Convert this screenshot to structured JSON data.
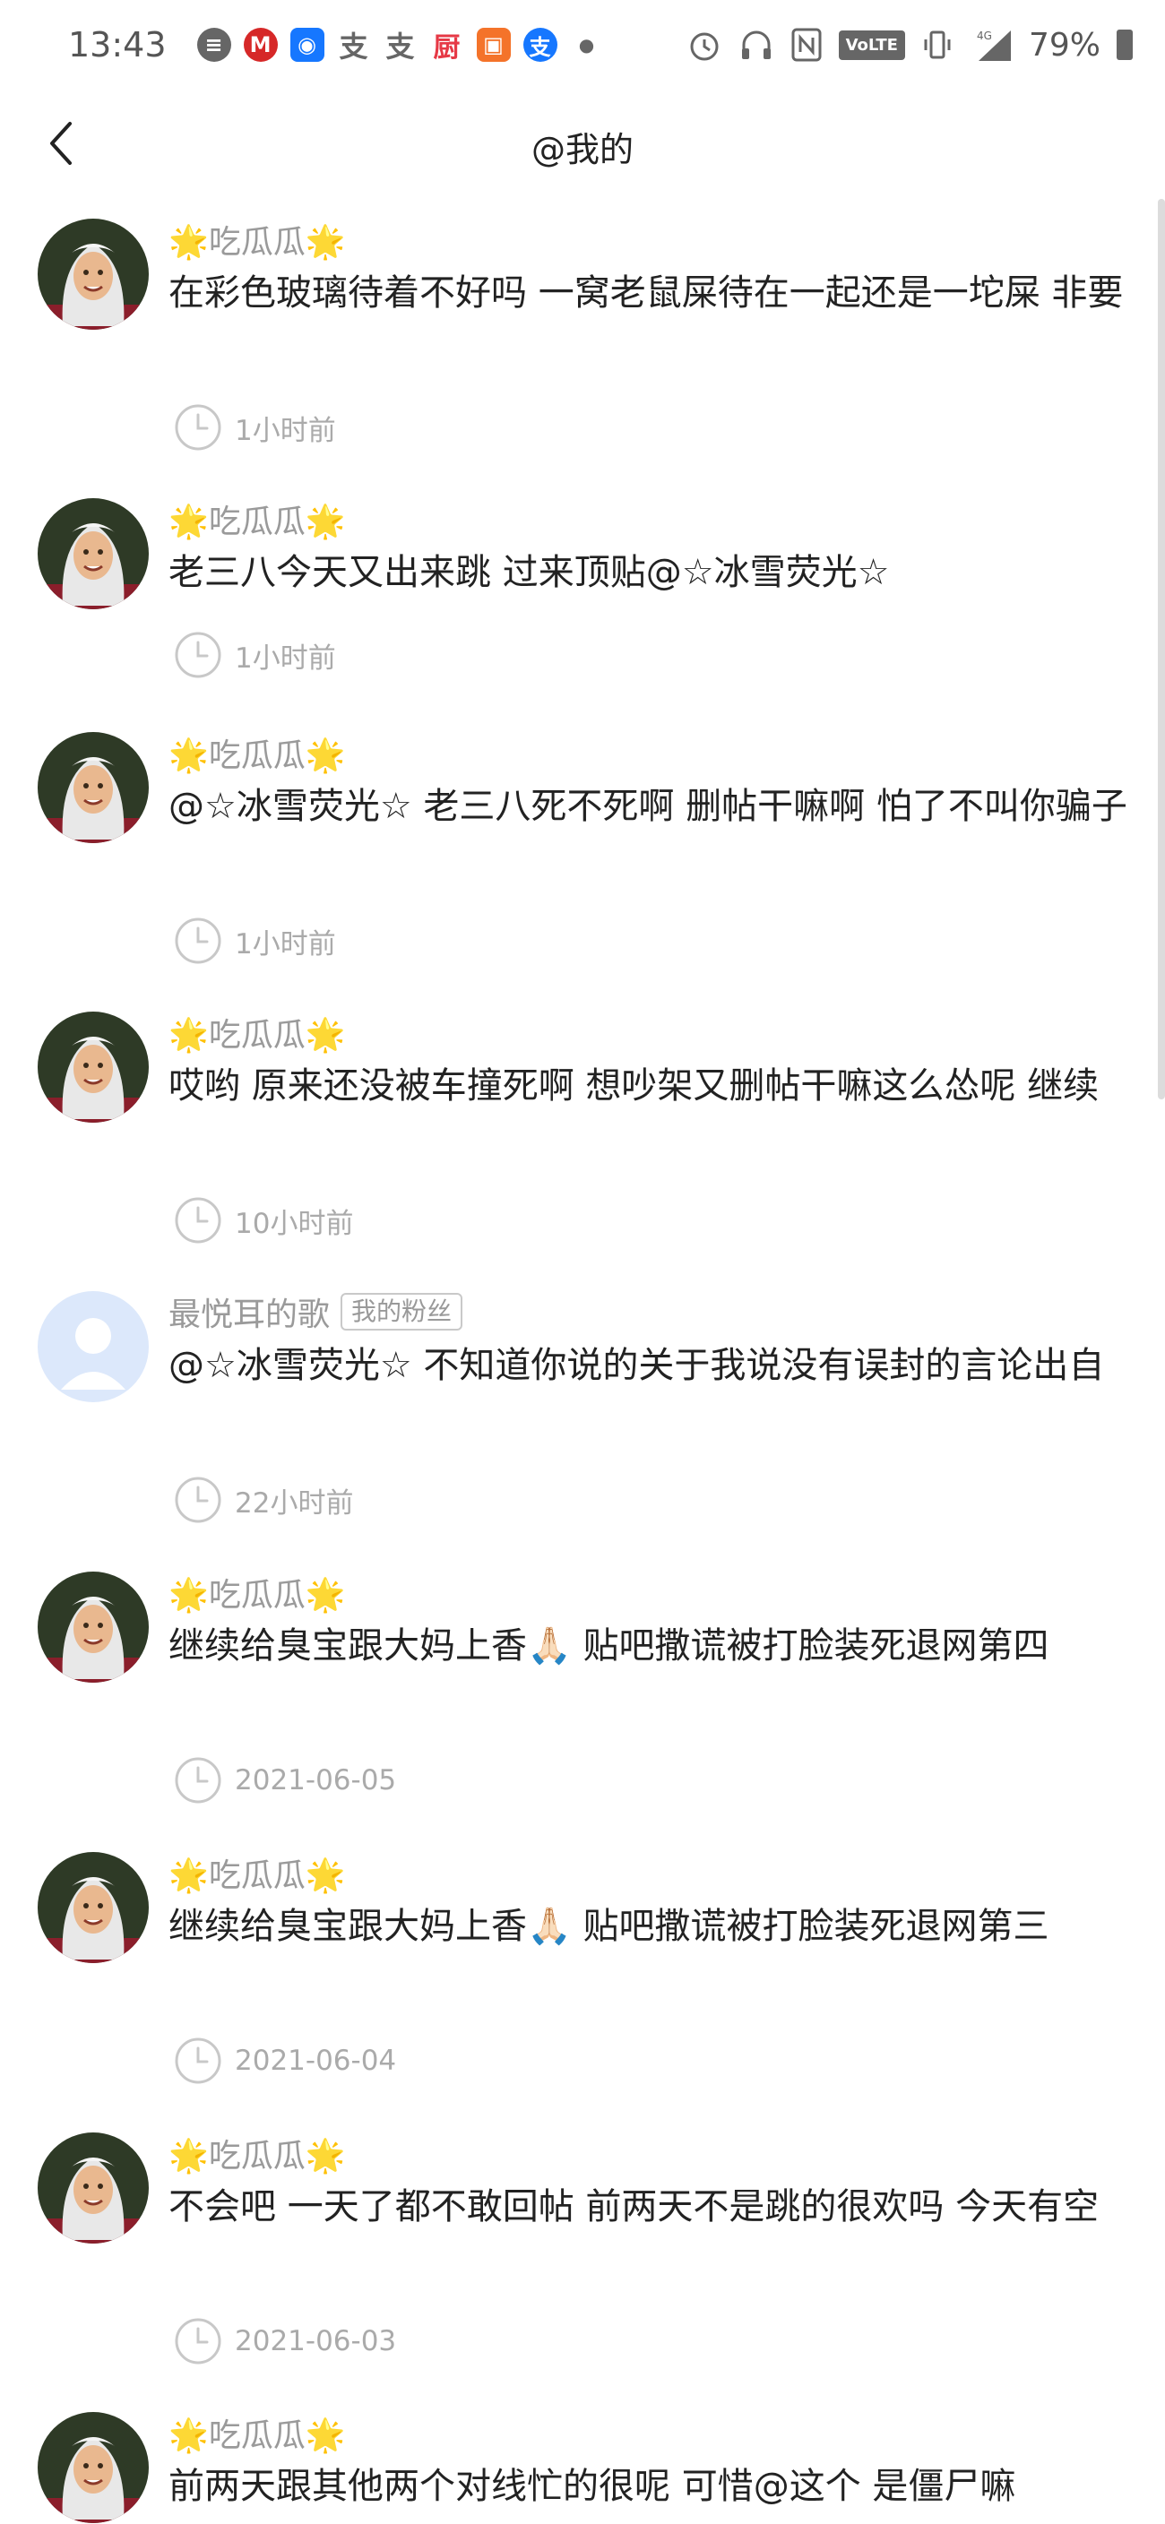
{
  "status_bar": {
    "time": "13:43",
    "network": "4G",
    "volte": "VoLTE",
    "battery": "79%"
  },
  "header": {
    "title": "@我的"
  },
  "comments": [
    {
      "user": "🌟吃瓜瓜🌟",
      "avatar": "user-avatar",
      "badge": "",
      "content": "在彩色玻璃待着不好吗 一窝老鼠屎待在一起还是一坨屎 非要",
      "time": "1小时前"
    },
    {
      "user": "🌟吃瓜瓜🌟",
      "avatar": "user-avatar",
      "badge": "",
      "content": "老三八今天又出来跳 过来顶贴@☆冰雪荧光☆",
      "time": "1小时前"
    },
    {
      "user": "🌟吃瓜瓜🌟",
      "avatar": "user-avatar",
      "badge": "",
      "content": " @☆冰雪荧光☆ 老三八死不死啊 删帖干嘛啊 怕了不叫你骗子",
      "time": "1小时前"
    },
    {
      "user": "🌟吃瓜瓜🌟",
      "avatar": "user-avatar",
      "badge": "",
      "content": "哎哟 原来还没被车撞死啊 想吵架又删帖干嘛这么怂呢 继续",
      "time": "10小时前"
    },
    {
      "user": "最悦耳的歌",
      "avatar": "default-avatar",
      "badge": "我的粉丝",
      "content": " @☆冰雪荧光☆ 不知道你说的关于我说没有误封的言论出自",
      "time": "22小时前"
    },
    {
      "user": "🌟吃瓜瓜🌟",
      "avatar": "user-avatar",
      "badge": "",
      "content": "继续给臭宝跟大妈上香🙏🏻 贴吧撒谎被打脸装死退网第四",
      "time": "2021-06-05"
    },
    {
      "user": "🌟吃瓜瓜🌟",
      "avatar": "user-avatar",
      "badge": "",
      "content": "继续给臭宝跟大妈上香🙏🏻 贴吧撒谎被打脸装死退网第三",
      "time": "2021-06-04"
    },
    {
      "user": "🌟吃瓜瓜🌟",
      "avatar": "user-avatar",
      "badge": "",
      "content": "不会吧 一天了都不敢回帖 前两天不是跳的很欢吗 今天有空",
      "time": "2021-06-03"
    },
    {
      "user": "🌟吃瓜瓜🌟",
      "avatar": "user-avatar",
      "badge": "",
      "content": "前两天跟其他两个对线忙的很呢 可惜@这个 是僵尸嘛",
      "time": ""
    }
  ]
}
